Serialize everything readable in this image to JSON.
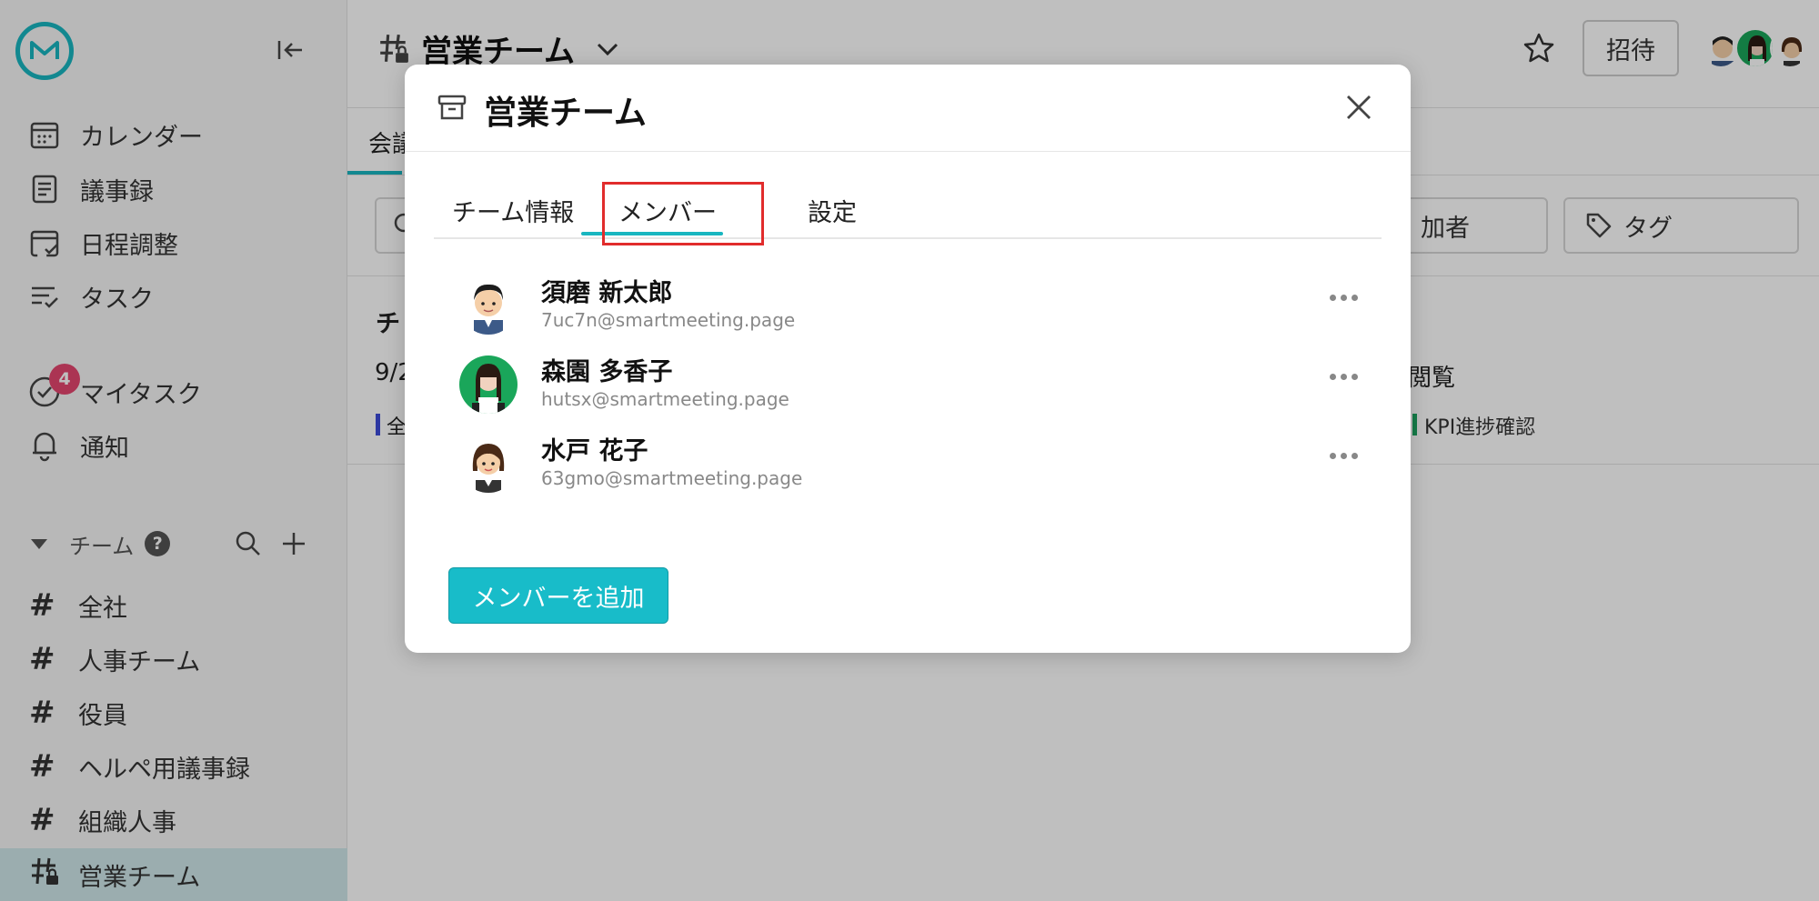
{
  "sidebar": {
    "nav": [
      {
        "label": "カレンダー",
        "icon": "calendar-icon"
      },
      {
        "label": "議事録",
        "icon": "document-icon"
      },
      {
        "label": "日程調整",
        "icon": "schedule-icon"
      },
      {
        "label": "タスク",
        "icon": "task-icon"
      }
    ],
    "mytask": {
      "label": "マイタスク",
      "badge": "4"
    },
    "notifications": {
      "label": "通知"
    },
    "teams_header": "チーム",
    "help": "?",
    "channels": [
      "全社",
      "人事チーム",
      "役員",
      "ヘルペ用議事録",
      "組織人事",
      "営業チーム"
    ]
  },
  "header": {
    "title": "営業チーム",
    "invite_label": "招待"
  },
  "background": {
    "tab_fragment": "会議",
    "participants_fragment": "加者",
    "tag_filter": "タグ",
    "row_title_fragment": "チ",
    "date_fragment": "9/2",
    "view_fragment": "閲覧",
    "label_fragment": "全",
    "kpi_tag": "KPI進捗確認"
  },
  "modal": {
    "title": "営業チーム",
    "tabs": [
      "チーム情報",
      "メンバー",
      "設定"
    ],
    "active_tab": "メンバー",
    "members": [
      {
        "name": "須磨 新太郎",
        "email": "7uc7n@smartmeeting.page"
      },
      {
        "name": "森園 多香子",
        "email": "hutsx@smartmeeting.page"
      },
      {
        "name": "水戸 花子",
        "email": "63gmo@smartmeeting.page"
      }
    ],
    "add_member_label": "メンバーを追加"
  },
  "colors": {
    "accent": "#18b6c0",
    "highlight": "#e12c2c",
    "badge": "#e5466f"
  }
}
